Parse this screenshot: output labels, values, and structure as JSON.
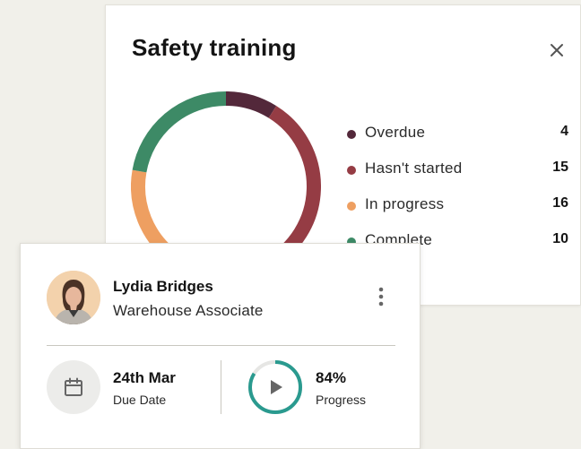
{
  "safety_card": {
    "title": "Safety training",
    "close_icon": "close-icon"
  },
  "chart_data": {
    "type": "pie",
    "categories": [
      "Overdue",
      "Hasn't started",
      "In progress",
      "Complete"
    ],
    "values": [
      4,
      15,
      16,
      10
    ],
    "colors": [
      "#53283a",
      "#953c44",
      "#ee9f61",
      "#3d8a66"
    ],
    "donut": true
  },
  "legend": [
    {
      "label": "Overdue",
      "value": "4",
      "color": "#53283a"
    },
    {
      "label": "Hasn't started",
      "value": "15",
      "color": "#953c44"
    },
    {
      "label": "In progress",
      "value": "16",
      "color": "#ee9f61"
    },
    {
      "label": "Complete",
      "value": "10",
      "color": "#3d8a66"
    }
  ],
  "person_card": {
    "name": "Lydia Bridges",
    "role": "Warehouse Associate",
    "due_date": "24th Mar",
    "due_label": "Due Date",
    "progress_value": "84%",
    "progress_label": "Progress",
    "progress_fraction": 0.84,
    "accent_color": "#2a9a8f",
    "icons": [
      "more-vertical-icon",
      "calendar-icon",
      "play-icon"
    ]
  }
}
